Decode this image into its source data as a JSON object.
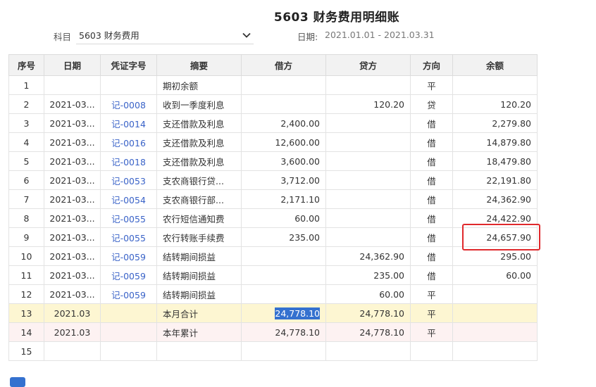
{
  "title": "5603 财务费用明细账",
  "filter": {
    "subject_label": "科目",
    "subject_value": "5603 财务费用",
    "date_label": "日期:",
    "date_value": "2021.01.01 - 2021.03.31"
  },
  "table": {
    "headers": [
      "序号",
      "日期",
      "凭证字号",
      "摘要",
      "借方",
      "贷方",
      "方向",
      "余额"
    ],
    "rows": [
      {
        "seq": "1",
        "date": "",
        "voucher": "",
        "summary": "期初余额",
        "debit": "",
        "credit": "",
        "dir": "平",
        "balance": ""
      },
      {
        "seq": "2",
        "date": "2021-03...",
        "voucher": "记-0008",
        "summary": "收到一季度利息",
        "debit": "",
        "credit": "120.20",
        "dir": "贷",
        "balance": "120.20"
      },
      {
        "seq": "3",
        "date": "2021-03...",
        "voucher": "记-0014",
        "summary": "支还借款及利息",
        "debit": "2,400.00",
        "credit": "",
        "dir": "借",
        "balance": "2,279.80"
      },
      {
        "seq": "4",
        "date": "2021-03...",
        "voucher": "记-0016",
        "summary": "支还借款及利息",
        "debit": "12,600.00",
        "credit": "",
        "dir": "借",
        "balance": "14,879.80"
      },
      {
        "seq": "5",
        "date": "2021-03...",
        "voucher": "记-0018",
        "summary": "支还借款及利息",
        "debit": "3,600.00",
        "credit": "",
        "dir": "借",
        "balance": "18,479.80"
      },
      {
        "seq": "6",
        "date": "2021-03...",
        "voucher": "记-0053",
        "summary": "支农商银行贷...",
        "debit": "3,712.00",
        "credit": "",
        "dir": "借",
        "balance": "22,191.80"
      },
      {
        "seq": "7",
        "date": "2021-03...",
        "voucher": "记-0054",
        "summary": "支农商银行部...",
        "debit": "2,171.10",
        "credit": "",
        "dir": "借",
        "balance": "24,362.90"
      },
      {
        "seq": "8",
        "date": "2021-03...",
        "voucher": "记-0055",
        "summary": "农行短信通知费",
        "debit": "60.00",
        "credit": "",
        "dir": "借",
        "balance": "24,422.90"
      },
      {
        "seq": "9",
        "date": "2021-03...",
        "voucher": "记-0055",
        "summary": "农行转账手续费",
        "debit": "235.00",
        "credit": "",
        "dir": "借",
        "balance": "24,657.90"
      },
      {
        "seq": "10",
        "date": "2021-03...",
        "voucher": "记-0059",
        "summary": "结转期间损益",
        "debit": "",
        "credit": "24,362.90",
        "dir": "借",
        "balance": "295.00"
      },
      {
        "seq": "11",
        "date": "2021-03...",
        "voucher": "记-0059",
        "summary": "结转期间损益",
        "debit": "",
        "credit": "235.00",
        "dir": "借",
        "balance": "60.00"
      },
      {
        "seq": "12",
        "date": "2021-03...",
        "voucher": "记-0059",
        "summary": "结转期间损益",
        "debit": "",
        "credit": "60.00",
        "dir": "平",
        "balance": ""
      },
      {
        "seq": "13",
        "date": "2021.03",
        "voucher": "",
        "summary": "本月合计",
        "debit": "24,778.10",
        "credit": "24,778.10",
        "dir": "平",
        "balance": ""
      },
      {
        "seq": "14",
        "date": "2021.03",
        "voucher": "",
        "summary": "本年累计",
        "debit": "24,778.10",
        "credit": "24,778.10",
        "dir": "平",
        "balance": ""
      },
      {
        "seq": "15",
        "date": "",
        "voucher": "",
        "summary": "",
        "debit": "",
        "credit": "",
        "dir": "",
        "balance": ""
      }
    ]
  },
  "colors": {
    "voucher_link": "#3a63c8",
    "highlight_box": "#e0292c",
    "month_sum_bg": "#fdf6d2",
    "year_sum_bg": "#fdf2f2",
    "selection": "#3471cf"
  },
  "icons": {
    "select_chevron": "chevron-down-icon"
  }
}
